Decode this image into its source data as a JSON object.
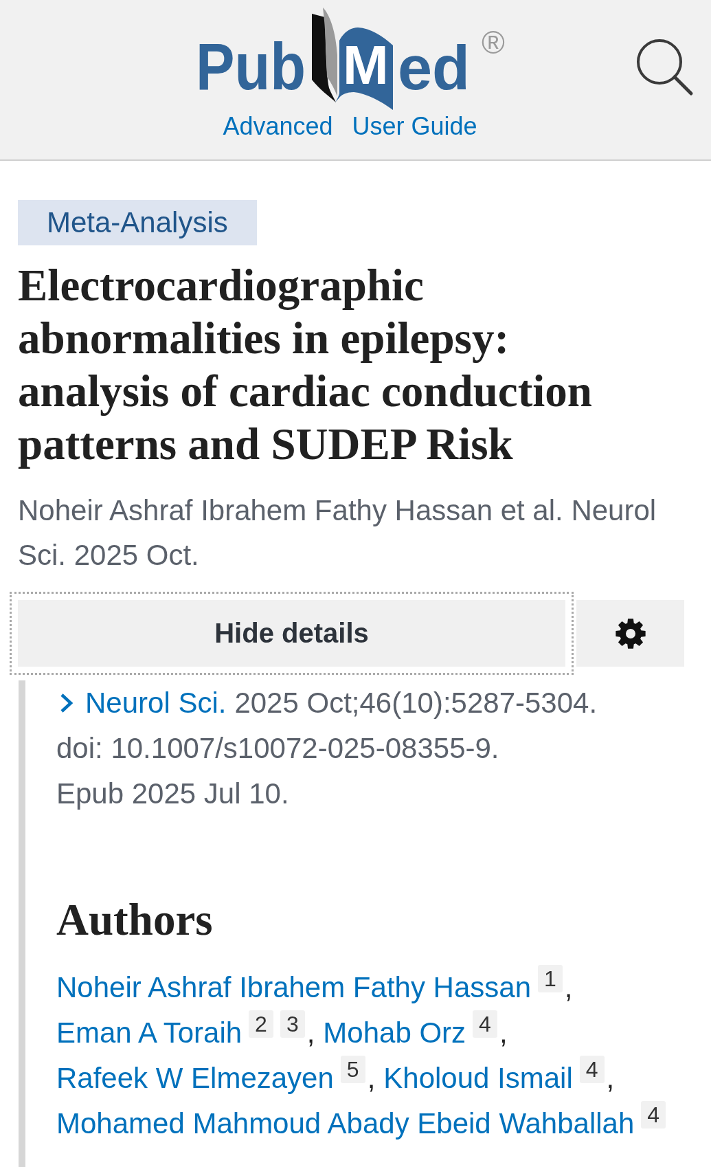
{
  "header": {
    "logo": {
      "left": "Pub",
      "right": "Med",
      "mark": "®"
    },
    "links": [
      "Advanced",
      "User Guide"
    ]
  },
  "article": {
    "type_tag": "Meta-Analysis",
    "title": "Electrocardiographic abnormalities in epilepsy: analysis of cardiac conduction patterns and SUDEP Risk",
    "citation": "Noheir Ashraf Ibrahem Fathy Hassan et al. Neurol Sci. 2025 Oct."
  },
  "details_toggle": {
    "label": "Hide details",
    "focused": true
  },
  "details": {
    "journal": "Neurol Sci.",
    "citation": "2025 Oct;46(10):5287-5304.",
    "doi": "doi: 10.1007/s10072-025-08355-9.",
    "epub": "Epub 2025 Jul 10."
  },
  "authors": {
    "heading": "Authors",
    "separator": ",",
    "list": [
      {
        "name": "Noheir Ashraf Ibrahem Fathy Hassan",
        "affiliations": [
          "1"
        ]
      },
      {
        "name": "Eman A Toraih",
        "affiliations": [
          "2",
          "3"
        ]
      },
      {
        "name": "Mohab Orz",
        "affiliations": [
          "4"
        ]
      },
      {
        "name": "Rafeek W Elmezayen",
        "affiliations": [
          "5"
        ]
      },
      {
        "name": "Kholoud Ismail",
        "affiliations": [
          "4"
        ]
      },
      {
        "name": "Mohamed Mahmoud Abady Ebeid Wahballah",
        "affiliations": [
          "4"
        ]
      }
    ]
  }
}
